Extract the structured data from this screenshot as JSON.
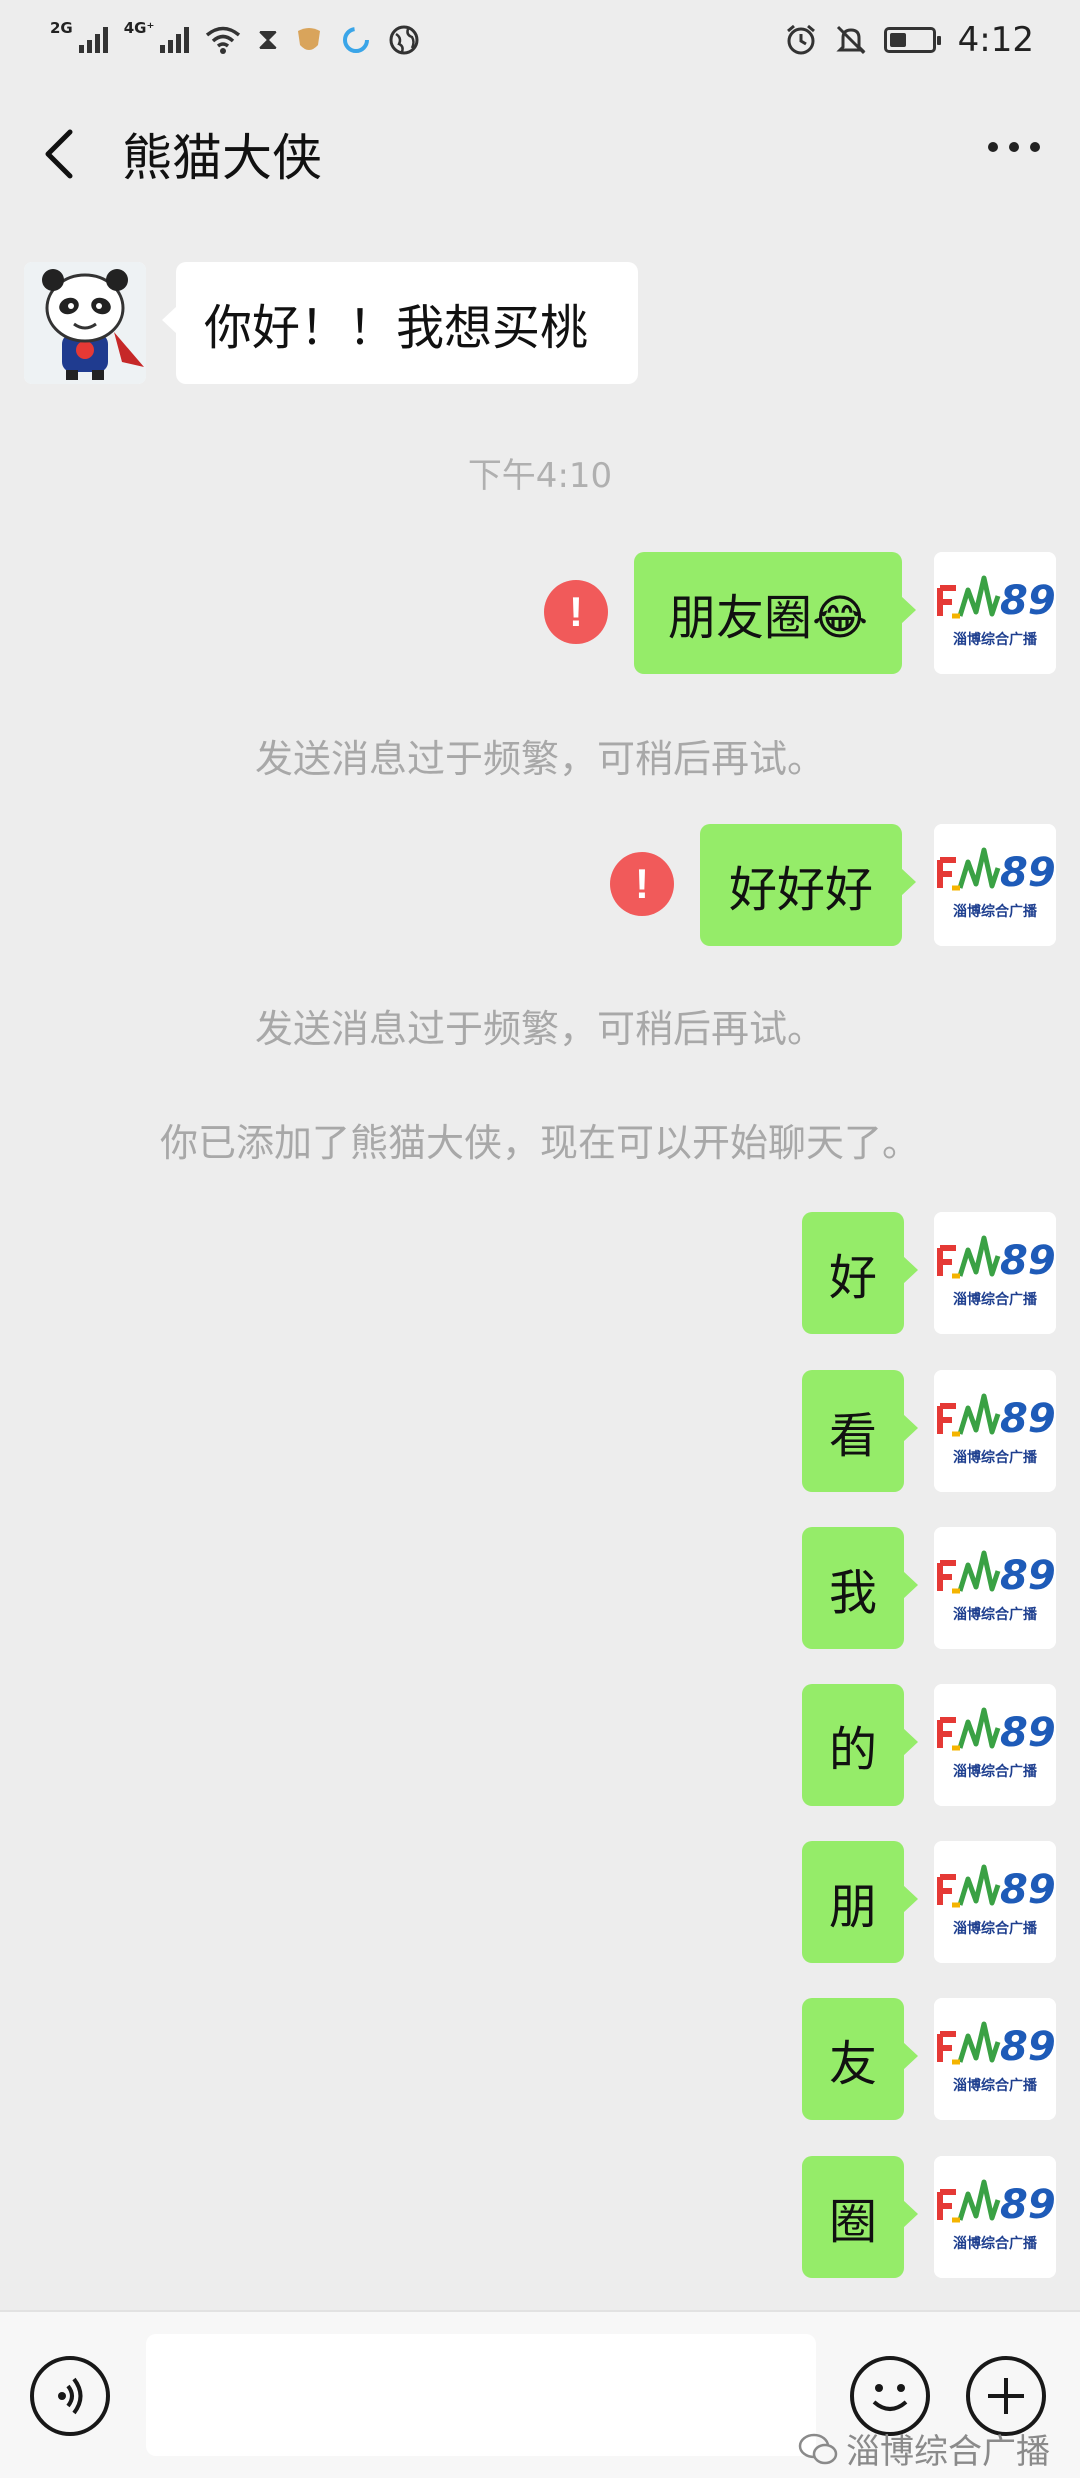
{
  "status_bar": {
    "net1": "2G",
    "net2": "4G⁺",
    "time": "4:12",
    "battery_level": 0.4
  },
  "header": {
    "title": "熊猫大侠"
  },
  "messages": [
    {
      "text": "你好！！我想买桃"
    },
    {
      "text": "朋友圈😂"
    },
    {
      "text": "好好好"
    },
    {
      "text": "好"
    },
    {
      "text": "看"
    },
    {
      "text": "我"
    },
    {
      "text": "的"
    },
    {
      "text": "朋"
    },
    {
      "text": "友"
    },
    {
      "text": "圈"
    }
  ],
  "timestamp": "下午4:10",
  "error_mark": "!",
  "system_notices": {
    "rate_limit_1": "发送消息过于频繁，可稍后再试。",
    "rate_limit_2": "发送消息过于频繁，可稍后再试。",
    "added_friend": "你已添加了熊猫大侠，现在可以开始聊天了。"
  },
  "avatar_logo": {
    "text": "FM89",
    "subtext": "淄博综合广播"
  },
  "input": {
    "value": "",
    "placeholder": ""
  },
  "watermark": "淄博综合广播",
  "colors": {
    "background": "#ededed",
    "bubble_out": "#95ec69",
    "bubble_in": "#ffffff",
    "error": "#f15a5a",
    "system_text": "#a8a8a8"
  }
}
